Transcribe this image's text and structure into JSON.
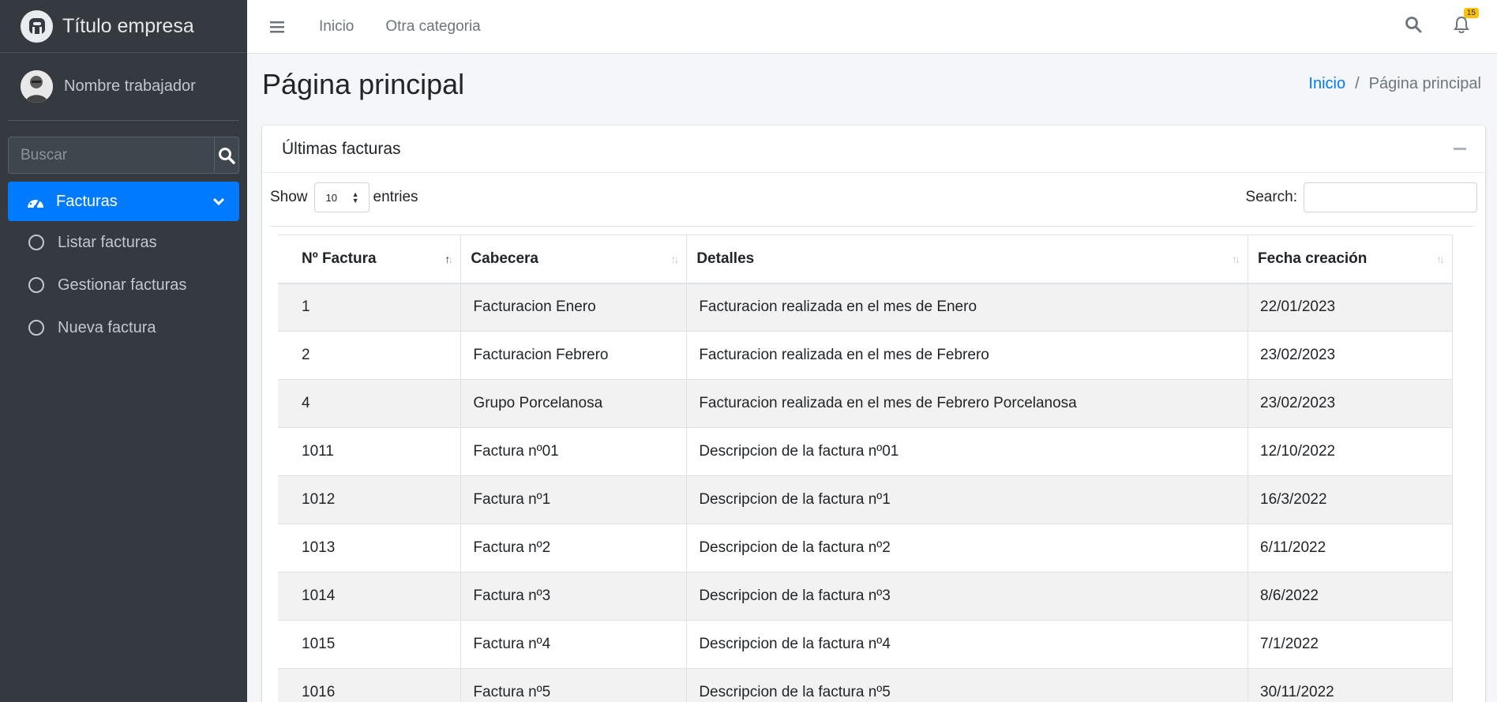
{
  "brand": {
    "title": "Título empresa"
  },
  "user": {
    "name": "Nombre trabajador"
  },
  "sidebar": {
    "search_placeholder": "Buscar",
    "active_item": "Facturas",
    "items": [
      {
        "label": "Listar facturas"
      },
      {
        "label": "Gestionar facturas"
      },
      {
        "label": "Nueva factura"
      }
    ]
  },
  "topbar": {
    "links": [
      "Inicio",
      "Otra categoria"
    ],
    "notification_count": "15"
  },
  "header": {
    "title": "Página principal",
    "breadcrumb": [
      "Inicio",
      "/",
      "Página principal"
    ]
  },
  "card": {
    "title": "Últimas facturas",
    "show_label": "Show",
    "length_value": "10",
    "entries_label": "entries",
    "search_label": "Search:"
  },
  "table": {
    "columns": [
      "Nº Factura",
      "Cabecera",
      "Detalles",
      "Fecha creación"
    ],
    "rows": [
      [
        "1",
        "Facturacion Enero",
        "Facturacion realizada en el mes de Enero",
        "22/01/2023"
      ],
      [
        "2",
        "Facturacion Febrero",
        "Facturacion realizada en el mes de Febrero",
        "23/02/2023"
      ],
      [
        "4",
        "Grupo Porcelanosa",
        "Facturacion realizada en el mes de Febrero Porcelanosa",
        "23/02/2023"
      ],
      [
        "1011",
        "Factura nº01",
        "Descripcion de la factura nº01",
        "12/10/2022"
      ],
      [
        "1012",
        "Factura nº1",
        "Descripcion de la factura nº1",
        "16/3/2022"
      ],
      [
        "1013",
        "Factura nº2",
        "Descripcion de la factura nº2",
        "6/11/2022"
      ],
      [
        "1014",
        "Factura nº3",
        "Descripcion de la factura nº3",
        "8/6/2022"
      ],
      [
        "1015",
        "Factura nº4",
        "Descripcion de la factura nº4",
        "7/1/2022"
      ],
      [
        "1016",
        "Factura nº5",
        "Descripcion de la factura nº5",
        "30/11/2022"
      ]
    ]
  },
  "colors": {
    "accent": "#007bff",
    "sidebar_bg": "#343a40",
    "badge": "#ffc107"
  }
}
